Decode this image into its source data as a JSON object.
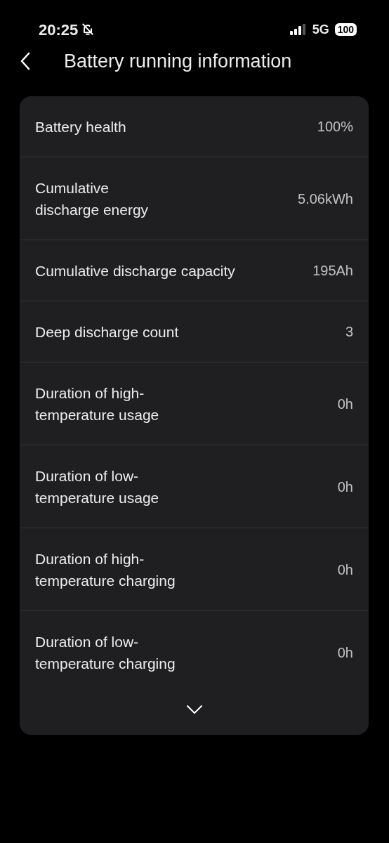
{
  "status_bar": {
    "time": "20:25",
    "network": "5G",
    "battery": "100"
  },
  "header": {
    "title": "Battery running information"
  },
  "rows": [
    {
      "label": [
        "Battery health"
      ],
      "value": "100%"
    },
    {
      "label": [
        "Cumulative",
        "discharge energy"
      ],
      "value": "5.06kWh"
    },
    {
      "label": [
        "Cumulative discharge capacity"
      ],
      "value": "195Ah"
    },
    {
      "label": [
        "Deep discharge count"
      ],
      "value": "3"
    },
    {
      "label": [
        "Duration of high-",
        "temperature usage"
      ],
      "value": "0h"
    },
    {
      "label": [
        "Duration of low-",
        "temperature usage"
      ],
      "value": "0h"
    },
    {
      "label": [
        "Duration of high-",
        "temperature charging"
      ],
      "value": "0h"
    },
    {
      "label": [
        "Duration of low-",
        "temperature charging"
      ],
      "value": "0h"
    }
  ]
}
